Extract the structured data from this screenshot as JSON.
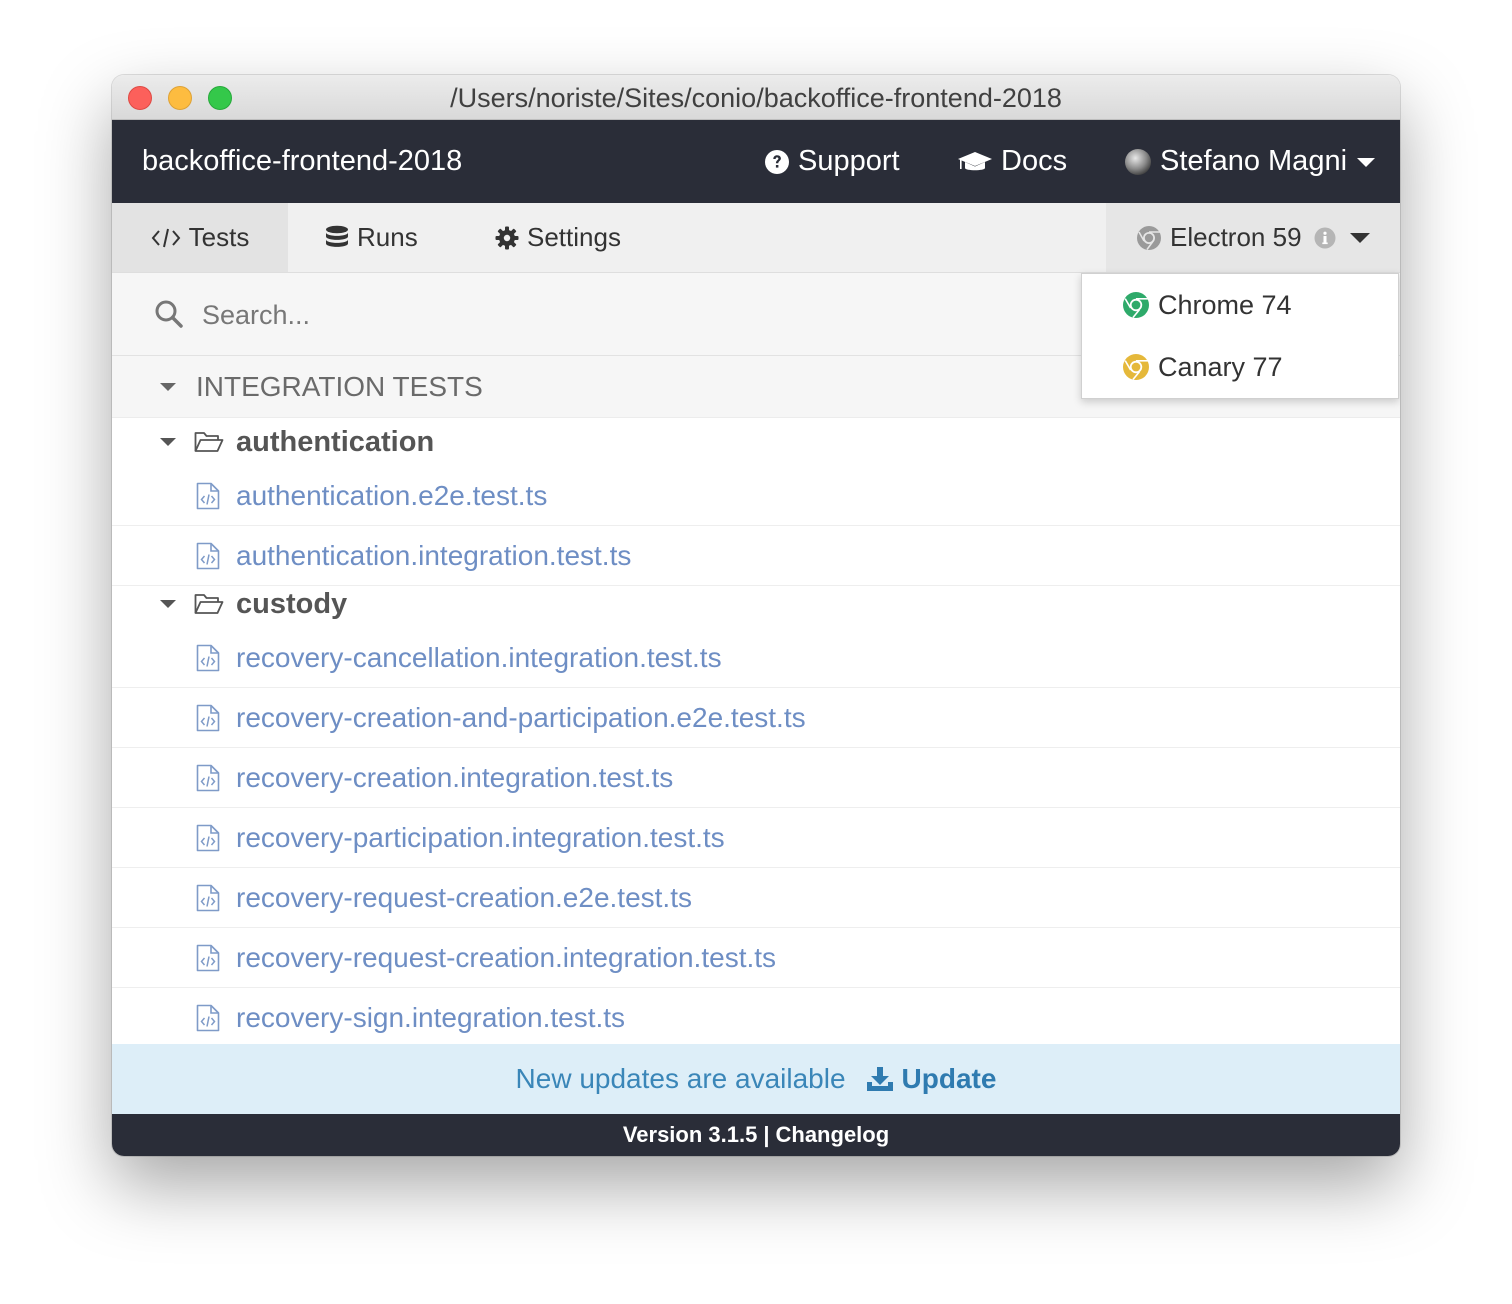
{
  "window": {
    "title": "/Users/noriste/Sites/conio/backoffice-frontend-2018"
  },
  "header": {
    "app_name": "backoffice-frontend-2018",
    "support_label": "Support",
    "docs_label": "Docs",
    "user_name": "Stefano Magni"
  },
  "tabs": [
    {
      "label": "Tests",
      "icon": "code-icon",
      "active": true
    },
    {
      "label": "Runs",
      "icon": "database-icon",
      "active": false
    },
    {
      "label": "Settings",
      "icon": "gear-icon",
      "active": false
    }
  ],
  "browser": {
    "selected": "Electron 59",
    "options": [
      {
        "label": "Chrome 74",
        "color": "#2eaa6a"
      },
      {
        "label": "Canary 77",
        "color": "#e5b83a"
      }
    ]
  },
  "search": {
    "placeholder": "Search..."
  },
  "specs": {
    "section_title": "INTEGRATION TESTS",
    "folders": [
      {
        "name": "authentication",
        "files": [
          "authentication.e2e.test.ts",
          "authentication.integration.test.ts"
        ]
      },
      {
        "name": "custody",
        "files": [
          "recovery-cancellation.integration.test.ts",
          "recovery-creation-and-participation.e2e.test.ts",
          "recovery-creation.integration.test.ts",
          "recovery-participation.integration.test.ts",
          "recovery-request-creation.e2e.test.ts",
          "recovery-request-creation.integration.test.ts",
          "recovery-sign.integration.test.ts"
        ]
      }
    ]
  },
  "updates": {
    "message": "New updates are available",
    "button_label": "Update"
  },
  "footer": {
    "version": "Version 3.1.5",
    "separator": "|",
    "changelog": "Changelog"
  },
  "colors": {
    "nav_bg": "#2a2d38",
    "link": "#6e8ec4",
    "update_bg": "#ddeef8",
    "update_text": "#3a86b8"
  }
}
